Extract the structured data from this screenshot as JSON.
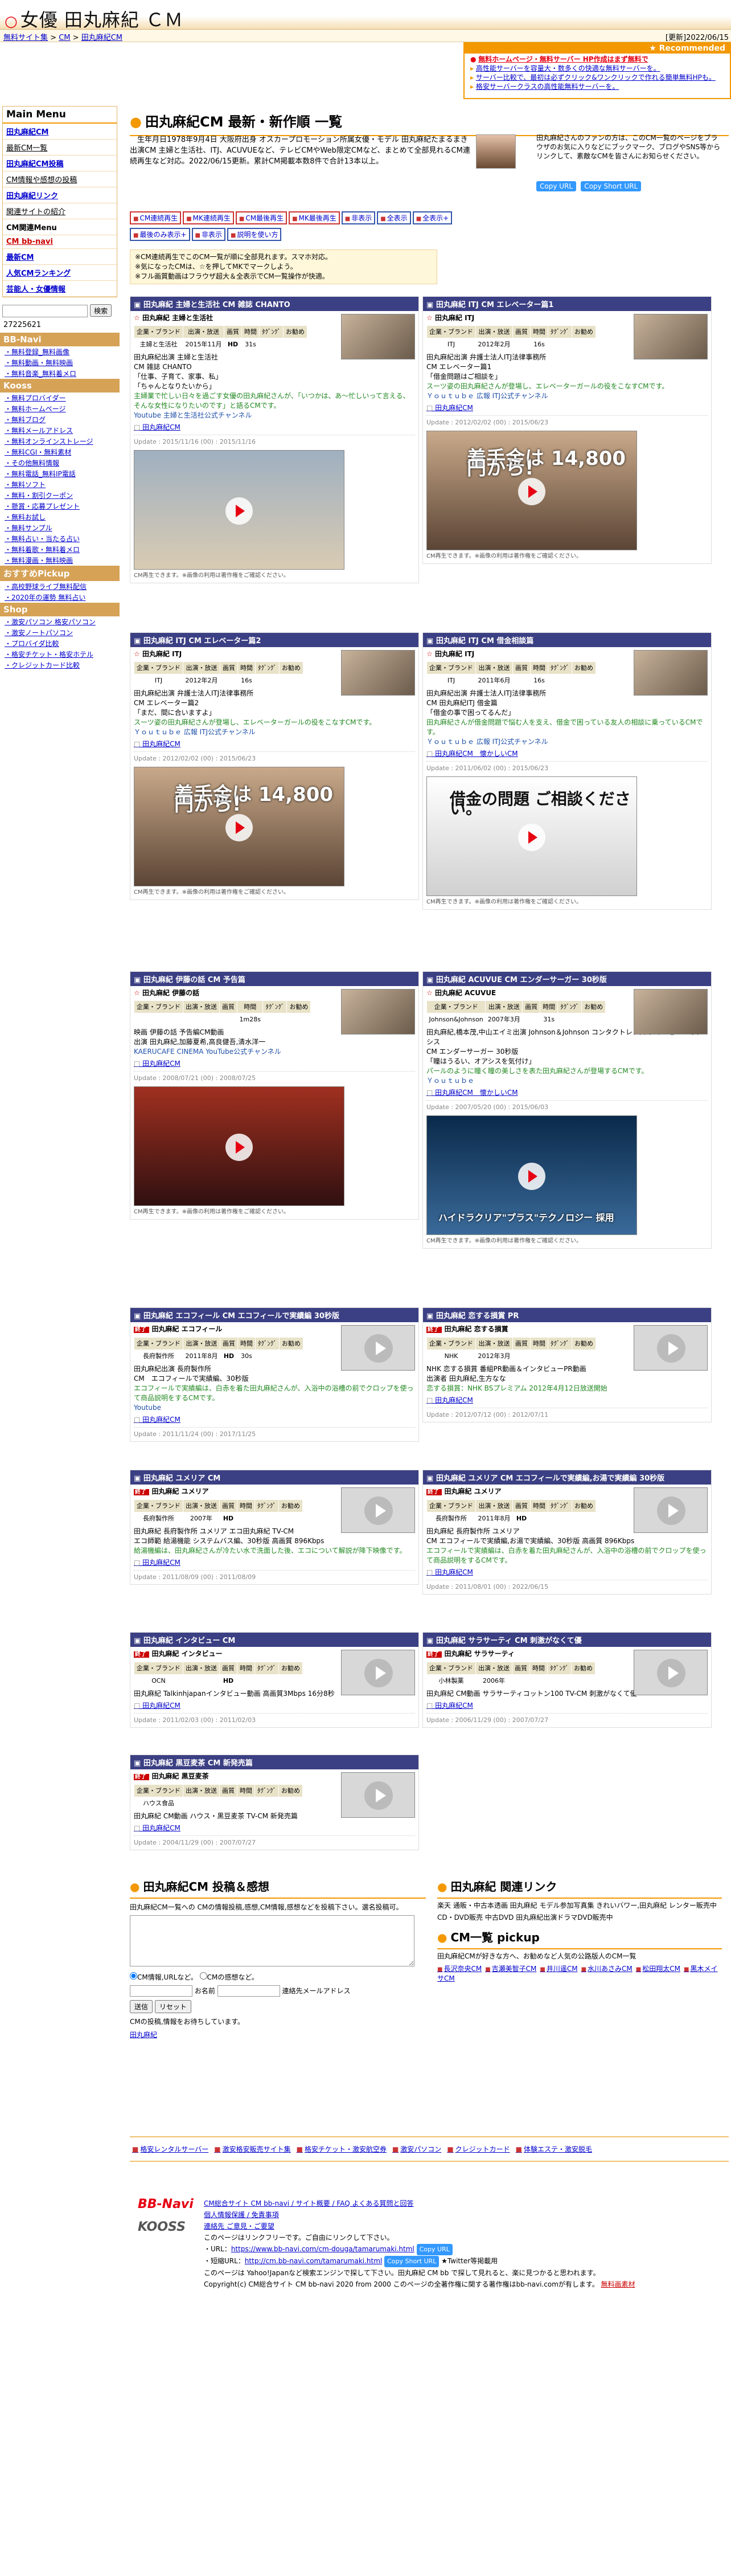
{
  "header": {
    "title": "女優 田丸麻紀 ＣＭ",
    "title_mark": "○"
  },
  "breadcrumb": {
    "items": [
      "無料サイト集",
      "CM",
      "田丸麻紀CM"
    ],
    "separator": ">",
    "updated": "[更新]2022/06/15"
  },
  "recommend": {
    "heading": "★ Recommended",
    "items": [
      "無料ホームページ・無料サーバー HP作成はまず無料で",
      "高性能サーバーを容量大・数多くの快適な無料サーバーを。",
      "サーバー比較で、最初は必ずクリック&ワンクリックで作れる簡単無料HPも。",
      "格安サーバークラスの高性能無料サーバーを。"
    ]
  },
  "sidebar": {
    "main_menu": "Main Menu",
    "items": [
      {
        "label": "田丸麻紀CM",
        "style": "link"
      },
      {
        "label": "最新CM一覧",
        "style": "plain"
      },
      {
        "label": "田丸麻紀CM投稿",
        "style": "link"
      },
      {
        "label": "CM情報や感想の投稿",
        "style": "plain"
      },
      {
        "label": "田丸麻紀リンク",
        "style": "link"
      },
      {
        "label": "関連サイトの紹介",
        "style": "plain"
      },
      {
        "label": "CM関連Menu",
        "style": "bold"
      },
      {
        "label": "CM bb-navi",
        "style": "red"
      },
      {
        "label": "最新CM",
        "style": "link"
      },
      {
        "label": "人気CMランキング",
        "style": "link"
      },
      {
        "label": "芸能人・女優情報",
        "style": "link"
      }
    ],
    "search_value": "",
    "search_button": "検索",
    "count": "27225621",
    "sections": [
      {
        "title": "BB-Navi",
        "items": [
          "無料登録_無料画像",
          "無料動画・無料映画",
          "無料音楽_無料着メロ"
        ]
      },
      {
        "title": "Kooss",
        "items": [
          "無料プロバイダー",
          "無料ホームページ",
          "無料ブログ",
          "無料メールアドレス",
          "無料オンラインストレージ",
          "無料CGI・無料素材",
          "その他無料情報",
          "無料電話_無料IP電話",
          "無料ソフト",
          "無料・割引クーポン",
          "懸賞・応募プレゼント",
          "無料お試し",
          "無料サンプル",
          "無料占い・当たる占い",
          "無料着歌・無料着メロ",
          "無料漫画・無料映画"
        ]
      },
      {
        "title": "おすすめPickup",
        "items": [
          "高校野球ライブ無料配信",
          "2020年の運勢 無料占い"
        ]
      },
      {
        "title": "Shop",
        "items": [
          "激安パソコン 格安パソコン",
          "激安ノートパソコン",
          "プロバイダ比較",
          "格安チケット・格安ホテル",
          "クレジットカード比較"
        ]
      }
    ]
  },
  "main": {
    "title": "田丸麻紀CM 最新・新作順 一覧",
    "intro": "　生年月日1978年9月4日 大阪府出身 オスカープロモーション所属女優・モデル 田丸麻紀たまるまき出演CM 主婦と生活社、ITJ、ACUVUEなど、テレビCMやWeb限定CMなど、まとめて全部見れるCM連続再生など対応。2022/06/15更新。累計CM掲載本数8件で合計13本以上。",
    "fan_text": "田丸麻紀さんのファンの方は、このCM一覧のページをブラウザのお気に入りなどにブックマーク、ブログやSNS等からリンクして、素敵なCMを皆さんにお知らせください。",
    "copy_url": "Copy URL",
    "copy_short": "Copy Short URL",
    "tags": [
      "CM連続再生",
      "MK連続再生",
      "CM最後再生",
      "MK最後再生",
      "非表示",
      "全表示",
      "全表示+",
      "最後のみ表示+",
      "非表示",
      "説明を使い方"
    ],
    "notes": [
      "※CM連続再生でこのCM一覧が順に全部見れます。スマホ対応。",
      "※気になったCMは、☆を押してMKでマークしよう。",
      "※フル画質動画はフラウザ超大＆全表示でCM一覧操作が快適。"
    ]
  },
  "cards": [
    {
      "head": "田丸麻紀 主婦と生活社 CM 雑誌 CHANTO",
      "brand": "田丸麻紀 主婦と生活社",
      "ended": false,
      "cols": [
        "企業・ブランド",
        "出演・放送",
        "画質",
        "時間",
        "ﾀｸﾞﾝｸﾞ",
        "お勧め"
      ],
      "vals": [
        "主婦と生活社",
        "2015年11月",
        "HD",
        "31s",
        "",
        ""
      ],
      "lines": [
        "田丸麻紀出演 主婦と生活社",
        "CM 雑誌 CHANTO",
        "「仕事、子育て、家事、私」",
        "「ちゃんとなりたいから」"
      ],
      "green": "主婦業で忙しい日々を過ごす女優の田丸麻紀さんが、「いつかは、あ〜忙しいって言える、そんな女性になりたいのです」と語るCMです。",
      "blue": "Youtube 主婦と生活社公式チャンネル",
      "link": "田丸麻紀CM",
      "update": "Update : 2015/11/16 (00) : 2015/11/16",
      "video": "",
      "vcolor": "linear-gradient(#9fb0c0,#d9cbb3)",
      "vcap": "CM再生できます。※画像の利用は著作権をご確認ください。",
      "layout": "c1"
    },
    {
      "head": "田丸麻紀 ITJ CM エレベーター篇1",
      "brand": "田丸麻紀 ITJ",
      "ended": false,
      "cols": [
        "企業・ブランド",
        "出演・放送",
        "画質",
        "時間",
        "ﾀｸﾞﾝｸﾞ",
        "お勧め"
      ],
      "vals": [
        "ITJ",
        "2012年2月",
        "",
        "16s",
        "",
        ""
      ],
      "lines": [
        "田丸麻紀出演 弁護士法人ITJ法律事務所",
        "CM エレベーター篇1",
        "「借金問題はご相談を」"
      ],
      "green": "スーツ姿の田丸麻紀さんが登場し、エレベーターガールの役をこなすCMです。",
      "blue": "Ｙｏｕｔｕｂｅ 広報 ITJ公式チャンネル",
      "link": "田丸麻紀CM",
      "update": "Update : 2012/02/02 (00) : 2015/06/23",
      "video": "着手金は 14,800円から!",
      "vcolor": "linear-gradient(#c9a98a,#5b4535)",
      "vcap": "CM再生できます。※画像の利用は著作権をご確認ください。",
      "layout": "c2"
    },
    {
      "head": "田丸麻紀 ITJ CM エレベーター篇2",
      "brand": "田丸麻紀 ITJ",
      "ended": false,
      "cols": [
        "企業・ブランド",
        "出演・放送",
        "画質",
        "時間",
        "ﾀｸﾞﾝｸﾞ",
        "お勧め"
      ],
      "vals": [
        "ITJ",
        "2012年2月",
        "",
        "16s",
        "",
        ""
      ],
      "lines": [
        "田丸麻紀出演 弁護士法人ITJ法律事務所",
        "CM エレベーター篇2",
        "「まだ、間に合いますよ」"
      ],
      "green": "スーツ姿の田丸麻紀さんが登場し、エレベーターガールの役をこなすCMです。",
      "blue": "Ｙｏｕｔｕｂｅ 広報 ITJ公式チャンネル",
      "link": "田丸麻紀CM",
      "update": "Update : 2012/02/02 (00) : 2015/06/23",
      "video": "着手金は 14,800円から!",
      "vcolor": "linear-gradient(#c9a98a,#5b4535)",
      "vcap": "CM再生できます。※画像の利用は著作権をご確認ください。",
      "layout": "c3"
    },
    {
      "head": "田丸麻紀 ITJ CM 借金相談篇",
      "brand": "田丸麻紀 ITJ",
      "ended": false,
      "cols": [
        "企業・ブランド",
        "出演・放送",
        "画質",
        "時間",
        "ﾀｸﾞﾝｸﾞ",
        "お勧め"
      ],
      "vals": [
        "ITJ",
        "2011年6月",
        "",
        "16s",
        "",
        ""
      ],
      "lines": [
        "田丸麻紀出演 弁護士法人ITJ法律事務所",
        "CM 田丸麻紀ITJ 借金篇",
        "「借金の事で困ってるんだ」"
      ],
      "green": "田丸麻紀さんが借金問題で悩む人を支え、借金で困っている友人の相談に乗っているCMです。",
      "blue": "Ｙｏｕｔｕｂｅ 広報 ITJ公式チャンネル",
      "link": "田丸麻紀CM　懐かしいCM",
      "update": "Update : 2011/06/02 (00) : 2015/06/23",
      "video": "借金の問題 ご相談ください。",
      "vcolor": "linear-gradient(#ffffff,#d0d0d0)",
      "vcap": "CM再生できます。※画像の利用は著作権をご確認ください。",
      "layout": "c4"
    },
    {
      "head": "田丸麻紀 伊藤の話 CM 予告篇",
      "brand": "田丸麻紀 伊藤の話",
      "ended": false,
      "cols": [
        "企業・ブランド",
        "出演・放送",
        "画質",
        "時間",
        "ﾀｸﾞﾝｸﾞ",
        "お勧め"
      ],
      "vals": [
        "",
        "",
        "",
        "1m28s",
        "",
        ""
      ],
      "lines": [
        "映画 伊藤の話 予告編CM動画",
        "出演 田丸麻紀,加藤夏希,高良健吾,清水洋一"
      ],
      "green": "",
      "blue": "KAERUCAFE CINEMA YouTube公式チャンネル",
      "link": "田丸麻紀CM",
      "update": "Update : 2008/07/21 (00) : 2008/07/25",
      "video": "",
      "vcolor": "linear-gradient(#a03020,#301010)",
      "vcap": "CM再生できます。※画像の利用は著作権をご確認ください。",
      "layout": "c5"
    },
    {
      "head": "田丸麻紀 ACUVUE CM エンダーサーガー 30秒版",
      "brand": "田丸麻紀 ACUVUE",
      "ended": false,
      "cols": [
        "企業・ブランド",
        "出演・放送",
        "画質",
        "時間",
        "ﾀｸﾞﾝｸﾞ",
        "お勧め"
      ],
      "vals": [
        "Johnson&Johnson",
        "2007年3月",
        "",
        "31s",
        "",
        ""
      ],
      "lines": [
        "田丸麻紀,橋本茂,中山エイミ出演 Johnson＆Johnson コンタクトレンズ アキュビューオアシス",
        "CM エンダーサーガー 30秒版",
        "「瞳はうるい、オアシスを気付け」"
      ],
      "green": "パールのように瞳く瞳の美しさを表た田丸麻紀さんが登場するCMです。",
      "blue": "Ｙｏｕｔｕｂｅ",
      "link": "田丸麻紀CM　懐かしいCM",
      "update": "Update : 2007/05/20 (00) : 2015/06/03",
      "video": "ハイドラクリア\"プラス\"テクノロジー 採用",
      "vcolor": "linear-gradient(#0a2a4a,#3a6a9a)",
      "vcap": "CM再生できます。※画像の利用は著作権をご確認ください。",
      "layout": "c6"
    },
    {
      "head": "田丸麻紀 エコフィール CM エコフィールで実績編 30秒版",
      "brand": "田丸麻紀 エコフィール",
      "ended": true,
      "cols": [
        "企業・ブランド",
        "出演・放送",
        "画質",
        "時間",
        "ﾀｸﾞﾝｸﾞ",
        "お勧め"
      ],
      "vals": [
        "長府製作所",
        "2011年8月",
        "HD",
        "30s",
        "",
        ""
      ],
      "lines": [
        "田丸麻紀出演 長府製作所",
        "CM　エコフィールで実績編、30秒版"
      ],
      "green": "エコフィールで実績編は、白赤を着た田丸麻紀さんが、入浴中の浴槽の前でクロップを使って商品説明をするCMです。",
      "blue": "Youtube",
      "link": "田丸麻紀CM",
      "update": "Update : 2011/11/24 (00) : 2017/11/25",
      "video": "",
      "vcolor": "",
      "vcap": "",
      "layout": "c7"
    },
    {
      "head": "田丸麻紀 恋する損賞 PR",
      "brand": "田丸麻紀 恋する損賞",
      "ended": true,
      "cols": [
        "企業・ブランド",
        "出演・放送",
        "画質",
        "時間",
        "ﾀｸﾞﾝｸﾞ",
        "お勧め"
      ],
      "vals": [
        "NHK",
        "2012年3月",
        "",
        "",
        "",
        ""
      ],
      "lines": [
        "NHK 恋する損賞 番組PR動画＆インタビューPR動画",
        "出演者 田丸麻紀,生方なな"
      ],
      "green": "恋する損賞：NHK BSプレミアム 2012年4月12日放送開始",
      "blue": "",
      "link": "田丸麻紀CM",
      "update": "Update : 2012/07/12 (00) : 2012/07/11",
      "video": "",
      "vcolor": "",
      "vcap": "",
      "layout": "c8"
    },
    {
      "head": "田丸麻紀 ユメリア CM",
      "brand": "田丸麻紀 ユメリア",
      "ended": true,
      "cols": [
        "企業・ブランド",
        "出演・放送",
        "画質",
        "時間",
        "ﾀｸﾞﾝｸﾞ",
        "お勧め"
      ],
      "vals": [
        "長府製作所",
        "2007年",
        "HD",
        "",
        "",
        ""
      ],
      "lines": [
        "田丸麻紀 長府製作所 ユメリア エコ田丸麻紀 TV-CM",
        "エコ師範 給湯機能 システムバス編、30秒版 高画質 896Kbps"
      ],
      "green": "給湯機編は、田丸麻紀さんが冷たい水で洗面した後、エコについて解説が降下映像です。",
      "blue": "",
      "link": "田丸麻紀CM",
      "update": "Update : 2011/08/09 (00) : 2011/08/09",
      "video": "",
      "vcolor": "",
      "vcap": "",
      "layout": "c9"
    },
    {
      "head": "田丸麻紀 ユメリア CM エコフィールで実績編,お湯で実績編 30秒版",
      "brand": "田丸麻紀 ユメリア",
      "ended": true,
      "cols": [
        "企業・ブランド",
        "出演・放送",
        "画質",
        "時間",
        "ﾀｸﾞﾝｸﾞ",
        "お勧め"
      ],
      "vals": [
        "長府製作所",
        "2011年8月",
        "HD",
        "",
        "",
        ""
      ],
      "lines": [
        "田丸麻紀 長府製作所 ユメリア",
        "CM エコフィールで実績編,お湯で実績編、30秒版 高画質 896Kbps"
      ],
      "green": "エコフィールで実績編は、白赤を着た田丸麻紀さんが、入浴中の浴槽の前でクロップを使って商品説明をするCMです。",
      "blue": "",
      "link": "田丸麻紀CM",
      "update": "Update : 2011/08/01 (00) : 2022/06/15",
      "video": "",
      "vcolor": "",
      "vcap": "",
      "layout": "c10"
    },
    {
      "head": "田丸麻紀 インタビュー CM",
      "brand": "田丸麻紀 インタビュー",
      "ended": true,
      "cols": [
        "企業・ブランド",
        "出演・放送",
        "画質",
        "時間",
        "ﾀｸﾞﾝｸﾞ",
        "お勧め"
      ],
      "vals": [
        "OCN",
        "",
        "HD",
        "",
        "",
        ""
      ],
      "lines": [
        "田丸麻紀 Talkinhjapanインタビュー動画 高画質3Mbps 16分8秒"
      ],
      "green": "",
      "blue": "",
      "link": "田丸麻紀CM",
      "update": "Update : 2011/02/03 (00) : 2011/02/03",
      "video": "",
      "vcolor": "",
      "vcap": "",
      "layout": "c11"
    },
    {
      "head": "田丸麻紀 サラサーティ CM 刺激がなくて優",
      "brand": "田丸麻紀 サラサーティ",
      "ended": true,
      "cols": [
        "企業・ブランド",
        "出演・放送",
        "画質",
        "時間",
        "ﾀｸﾞﾝｸﾞ",
        "お勧め"
      ],
      "vals": [
        "小林製薬",
        "2006年",
        "",
        "",
        "",
        ""
      ],
      "lines": [
        "田丸麻紀 CM動画 サラサーティコットン100 TV-CM 刺激がなくて優"
      ],
      "green": "",
      "blue": "",
      "link": "田丸麻紀CM",
      "update": "Update : 2006/11/29 (00) : 2007/07/27",
      "video": "",
      "vcolor": "",
      "vcap": "",
      "layout": "c12"
    },
    {
      "head": "田丸麻紀 黒豆麦茶 CM 新発売篇",
      "brand": "田丸麻紀 黒豆麦茶",
      "ended": true,
      "cols": [
        "企業・ブランド",
        "出演・放送",
        "画質",
        "時間",
        "ﾀｸﾞﾝｸﾞ",
        "お勧め"
      ],
      "vals": [
        "ハウス食品",
        "",
        "",
        "",
        "",
        ""
      ],
      "lines": [
        "田丸麻紀 CM動画 ハウス・黒豆麦茶 TV-CM 新発売篇"
      ],
      "green": "",
      "blue": "",
      "link": "田丸麻紀CM",
      "update": "Update : 2004/11/29 (00) : 2007/07/27",
      "video": "",
      "vcolor": "",
      "vcap": "",
      "layout": "c13"
    }
  ],
  "post": {
    "title": "田丸麻紀CM 投稿＆感想",
    "desc": "田丸麻紀CM一覧への CMの情報投稿,感想,CM情報,感想などを投稿下さい。選名投稿可。",
    "radio1": "CM情報,URLなど。",
    "radio2": "CMの感想など。",
    "name_label": "お名前",
    "email_label": "連絡先メールアドレス",
    "submit": "送信",
    "reset": "リセット",
    "note": "CMの投稿,情報をお待ちしています。",
    "link": "田丸麻紀"
  },
  "related": {
    "title": "田丸麻紀 関連リンク",
    "desc": "楽天 通販・中古本透画 田丸麻紀 モデル参加写真集 きれいバワー,田丸麻紀 レンター販売中",
    "desc2": "CD・DVD販売 中古DVD 田丸麻紀出演ドラマDVD販売中",
    "pickup_title": "CM一覧 pickup",
    "pickup_desc": "田丸麻紀CMが好きな方へ、お勧めなど人気の公路版人のCM一覧",
    "pickup_links": [
      "長沢奈央CM",
      "吉瀬美智子CM",
      "井川遥CM",
      "水川あさみCM",
      "松田翔太CM",
      "黒木メイサCM"
    ]
  },
  "footer_links": [
    "格安レンタルサーバー",
    "激安格安販売サイト集",
    "格安チケット・激安航空券",
    "激安パソコン",
    "クレジットカード",
    "体験エステ・激安脱毛"
  ],
  "footer": {
    "logo1": "BB-Navi",
    "logo2": "KOOSS",
    "links1": "CM総合サイト CM bb-navi / サイト概要 / FAQ よくある質問と回答",
    "links2": "個人情報保護 / 免責事項",
    "links3": "連絡先 ご意見・ご要望",
    "share": "このページはリンクフリーです。ご自由にリンクして下さい。",
    "url_label": "URL：",
    "url": "https://www.bb-navi.com/cm-douga/tamarumaki.html",
    "short_label": "短縮URL：",
    "short_url": "http://cm.bb-navi.com/tamarumaki.html",
    "copy_url": "Copy URL",
    "copy_short": "Copy Short URL",
    "twitter": "★Twitter等掲載用",
    "note": "このページは Yahoo!Japanなど検索エンジンで探して下さい。田丸麻紀 CM bb で探して見れると、楽に見つかると思われます。",
    "copyright": "Copyright(c) CM総合サイト CM bb-navi 2020 from 2000 このページの全著作権に関する著作権はbb-navi.comが有します。",
    "free": "無料画素材"
  }
}
